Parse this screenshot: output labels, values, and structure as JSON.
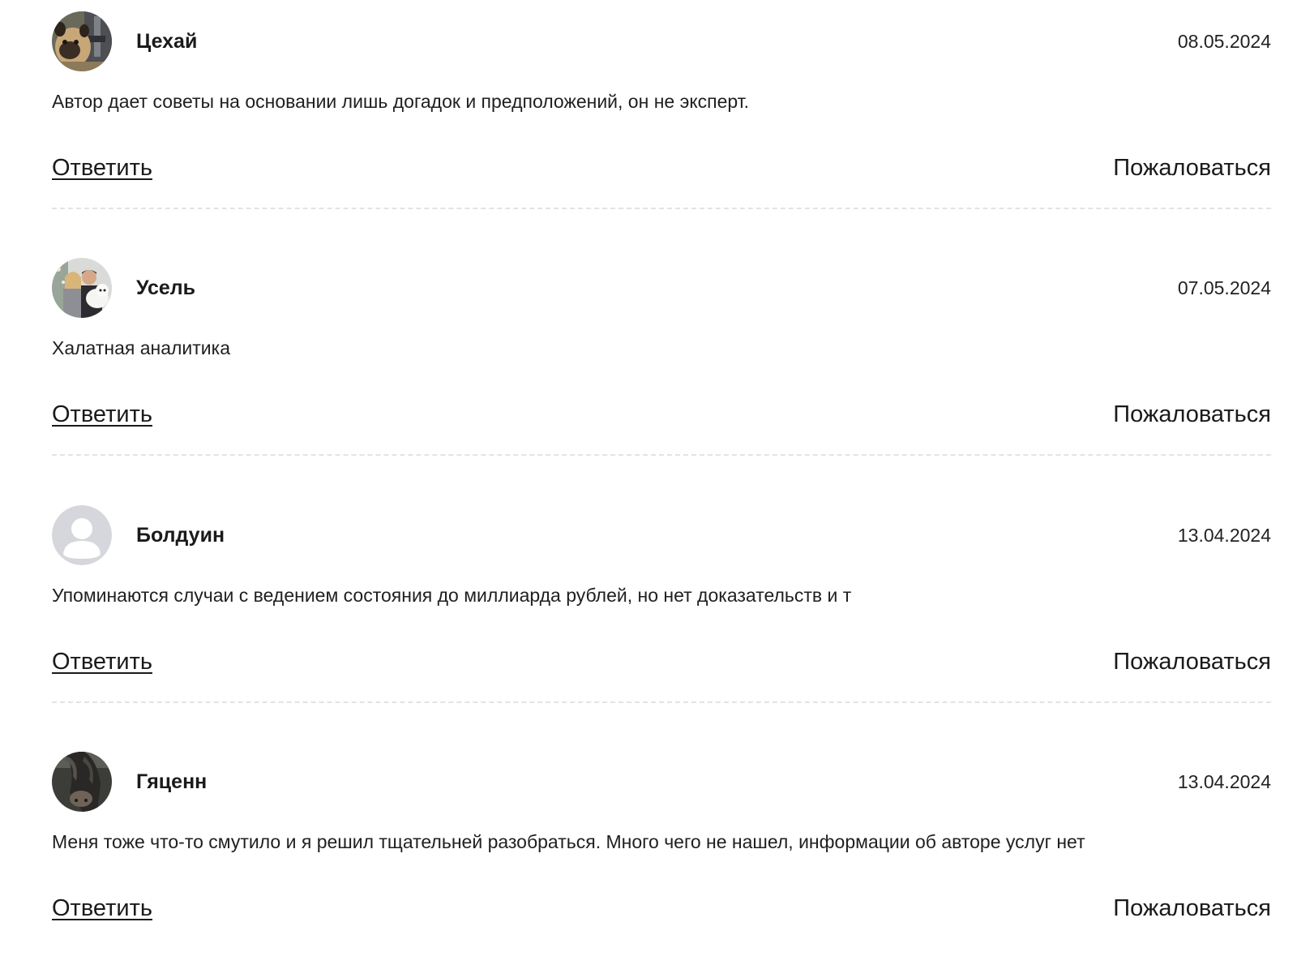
{
  "comments": [
    {
      "author": "Цехай",
      "date": "08.05.2024",
      "text": "Автор дает советы на основании лишь догадок и предположений, он не эксперт.",
      "reply_label": "Ответить",
      "report_label": "Пожаловаться",
      "avatar_icon": "photo-avatar-dog"
    },
    {
      "author": "Усель",
      "date": "07.05.2024",
      "text": "Халатная аналитика",
      "reply_label": "Ответить",
      "report_label": "Пожаловаться",
      "avatar_icon": "photo-avatar-couple"
    },
    {
      "author": "Болдуин",
      "date": "13.04.2024",
      "text": "Упоминаются случаи с ведением состояния до миллиарда рублей, но нет доказательств и т",
      "reply_label": "Ответить",
      "report_label": "Пожаловаться",
      "avatar_icon": "default-user-icon"
    },
    {
      "author": "Гяценн",
      "date": "13.04.2024",
      "text": "Меня тоже что-то смутило и я решил тщательней разобраться. Много чего не нашел, информации об авторе услуг нет",
      "reply_label": "Ответить",
      "report_label": "Пожаловаться",
      "avatar_icon": "photo-avatar-horse"
    }
  ],
  "colors": {
    "text": "#1a1a1a",
    "divider": "#e3e3e3",
    "default_avatar_bg": "#d5d7dc",
    "default_avatar_fg": "#ffffff"
  }
}
